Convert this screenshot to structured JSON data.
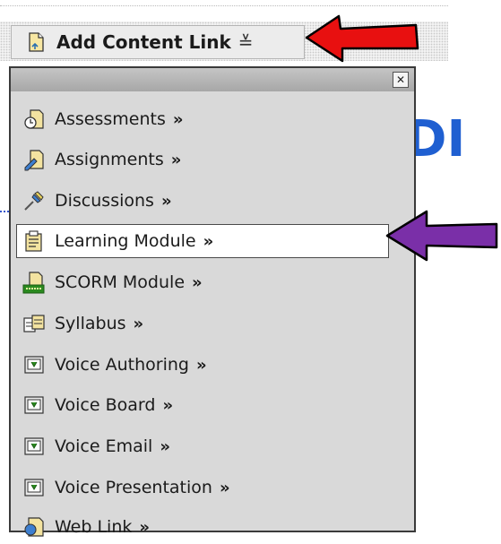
{
  "toolbar": {
    "add_content_link_label": "Add Content Link",
    "menu_glyph": "≚"
  },
  "background": {
    "title_fragment": "DI"
  },
  "menu": {
    "close_glyph": "✕",
    "chevron": "»",
    "items": [
      {
        "label": "Assessments",
        "icon": "assessment-clock-icon"
      },
      {
        "label": "Assignments",
        "icon": "assignment-pencil-icon"
      },
      {
        "label": "Discussions",
        "icon": "pushpin-icon"
      },
      {
        "label": "Learning Module",
        "icon": "learning-module-icon",
        "highlighted": true
      },
      {
        "label": "SCORM Module",
        "icon": "scorm-icon"
      },
      {
        "label": "Syllabus",
        "icon": "syllabus-book-icon"
      },
      {
        "label": "Voice Authoring",
        "icon": "voice-tool-icon"
      },
      {
        "label": "Voice Board",
        "icon": "voice-tool-icon"
      },
      {
        "label": "Voice Email",
        "icon": "voice-tool-icon"
      },
      {
        "label": "Voice Presentation",
        "icon": "voice-tool-icon"
      },
      {
        "label": "Web Link",
        "icon": "web-link-icon"
      }
    ]
  },
  "annotations": {
    "red_arrow_color": "#e81010",
    "purple_arrow_color": "#7a2fa8"
  }
}
